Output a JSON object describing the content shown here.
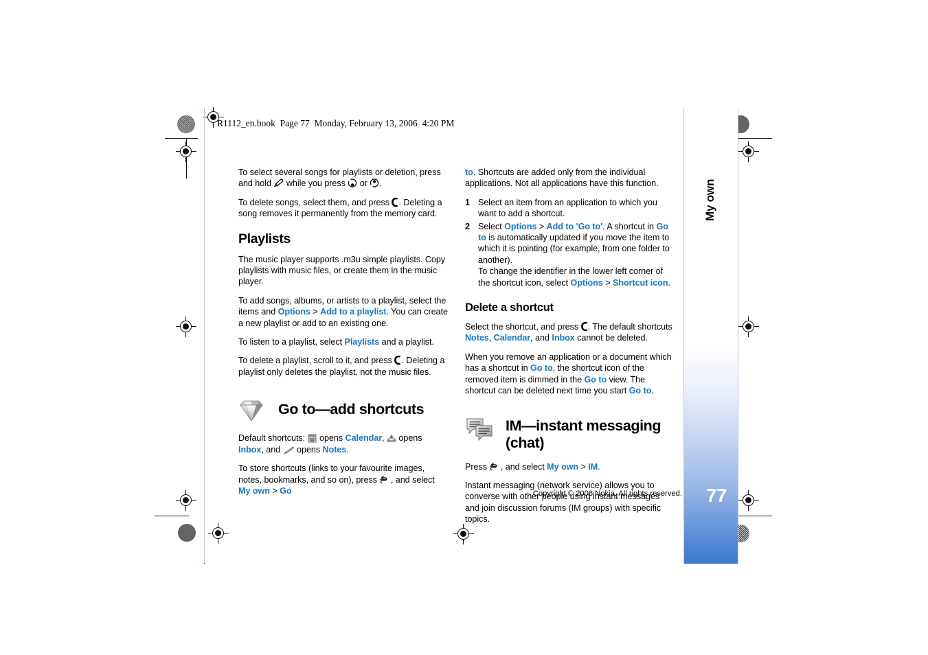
{
  "header": {
    "file_line": "R1112_en.book  Page 77  Monday, February 13, 2006  4:20 PM"
  },
  "side_tab": {
    "label": "My own",
    "page_number": "77"
  },
  "footer": {
    "copyright": "Copyright © 2006 Nokia. All rights reserved."
  },
  "left_column": {
    "p1": {
      "a": "To select several songs for playlists or deletion, press and hold",
      "b": "while you press",
      "c": "or",
      "d": "."
    },
    "p2": {
      "a": "To delete songs, select them, and press",
      "b": ". Deleting a song removes it permanently from the memory card."
    },
    "playlists_heading": "Playlists",
    "p3": "The music player supports .m3u simple playlists. Copy playlists with music files, or create them in the music player.",
    "p4": {
      "a": "To add songs, albums, or artists to a playlist, select the items and",
      "options": "Options",
      "gt": ">",
      "add_to_playlist": "Add to a playlist",
      "b": ". You can create a new playlist or add to an existing one."
    },
    "p5": {
      "a": "To listen to a playlist, select",
      "playlists_link": "Playlists",
      "b": "and a playlist."
    },
    "p6": {
      "a": "To delete a playlist, scroll to it, and press",
      "b": ". Deleting a playlist only deletes the playlist, not the music files."
    },
    "goto_heading": "Go to—add shortcuts",
    "p7": {
      "a": "Default shortcuts:",
      "opens1": "opens",
      "calendar": "Calendar",
      "comma1": ",",
      "opens2": "opens",
      "inbox": "Inbox",
      "comma2": ",",
      "and": "and",
      "opens3": "opens",
      "notes": "Notes",
      "period": "."
    },
    "p8": {
      "a": "To store shortcuts (links to your favourite images, notes, bookmarks, and so on), press",
      "b": ", and select",
      "my_own": "My own",
      "gt": ">",
      "go": "Go"
    }
  },
  "right_column": {
    "p1": {
      "to_link": "to",
      "a": ". Shortcuts are added only from the individual applications. Not all applications have this function."
    },
    "steps": [
      {
        "num": "1",
        "text": "Select an item from an application to which you want to add a shortcut."
      },
      {
        "num": "2",
        "pre": "Select",
        "options": "Options",
        "gt1": ">",
        "add_to_goto": "Add to 'Go to'",
        "mid": ". A shortcut in",
        "goto": "Go to",
        "post": "is automatically updated if you move the item to which it is pointing (for example, from one folder to another).",
        "sub_pre": "To change the identifier in the lower left corner of the shortcut icon, select",
        "sub_options": "Options",
        "gt2": ">",
        "shortcut_icon": "Shortcut icon",
        "sub_post": "."
      }
    ],
    "delete_heading": "Delete a shortcut",
    "p2": {
      "a": "Select the shortcut, and press",
      "b": ". The default shortcuts",
      "notes": "Notes",
      "comma1": ",",
      "calendar": "Calendar",
      "comma2": ", and",
      "inbox": "Inbox",
      "c": "cannot be deleted."
    },
    "p3": {
      "a": "When you remove an application or a document which has a shortcut in",
      "goto1": "Go to",
      "b": ", the shortcut icon of the removed item is dimmed in the",
      "goto2": "Go to",
      "c": "view. The shortcut can be deleted next time you start",
      "goto3": "Go to",
      "d": "."
    },
    "im_heading": "IM—instant messaging (chat)",
    "p4": {
      "a": "Press",
      "b": ", and select",
      "my_own": "My own",
      "gt": ">",
      "im": "IM",
      "c": "."
    },
    "p5": "Instant messaging (network service) allows you to converse with other people using instant messages and join discussion forums (IM groups) with specific topics."
  },
  "colors": {
    "link_blue": "#1577d4",
    "tab_blue": "#3d79cd",
    "text_black": "#000000"
  },
  "icons": {
    "pencil_key": "pencil-key-icon",
    "scroll_down_key": "scroll-down-key-icon",
    "scroll_up_key": "scroll-up-key-icon",
    "clear_key": "clear-key-icon",
    "menu_key": "menu-key-icon",
    "calendar": "calendar-icon",
    "inbox": "inbox-icon",
    "notes": "notes-pencil-icon",
    "gem": "gem-icon",
    "im": "im-chat-bubbles-icon"
  }
}
